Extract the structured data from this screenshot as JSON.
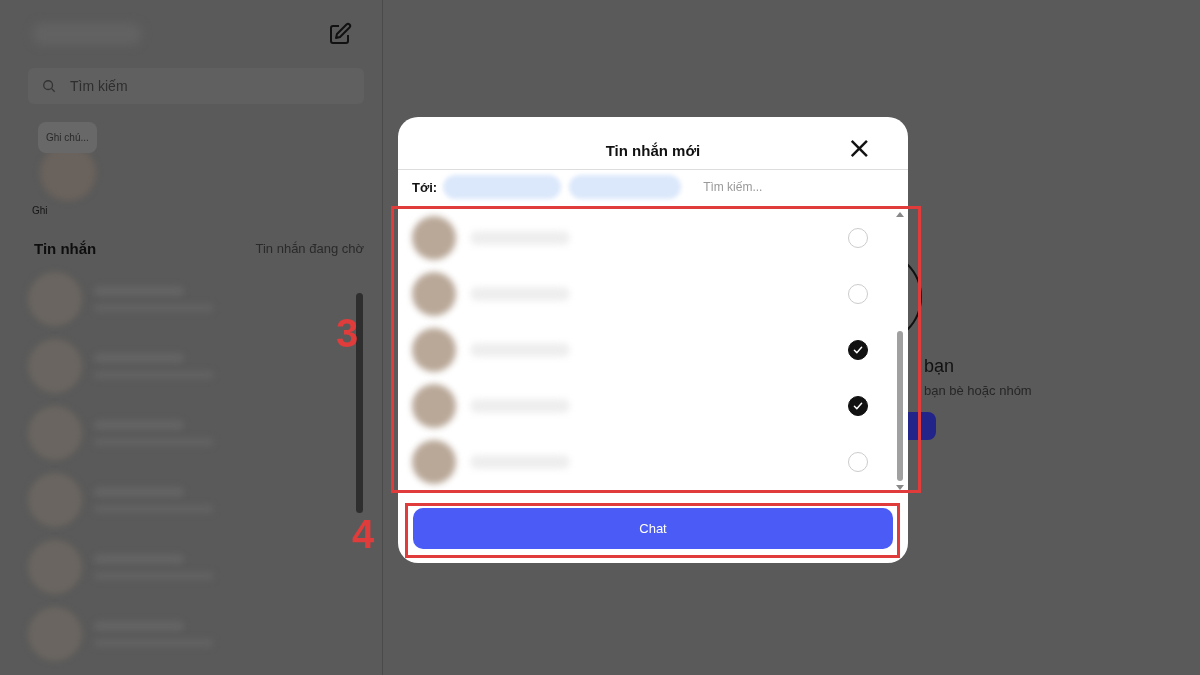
{
  "sidebar": {
    "search": {
      "placeholder": "Tìm kiếm"
    },
    "note": {
      "bubble": "Ghi chú...",
      "label": "Ghi"
    },
    "section_title": "Tin nhắn",
    "pending_link": "Tin nhắn đang chờ"
  },
  "main": {
    "title": "bạn",
    "subtitle": "bạn bè hoặc nhóm"
  },
  "dialog": {
    "title": "Tin nhắn mới",
    "close": "×",
    "to_label": "Tới:",
    "search": {
      "placeholder": "Tìm kiếm..."
    },
    "contacts": [
      {
        "checked": false
      },
      {
        "checked": false
      },
      {
        "checked": true
      },
      {
        "checked": true
      },
      {
        "checked": false
      }
    ],
    "button": "Chat"
  },
  "annotations": [
    {
      "label": "3"
    },
    {
      "label": "4"
    }
  ]
}
